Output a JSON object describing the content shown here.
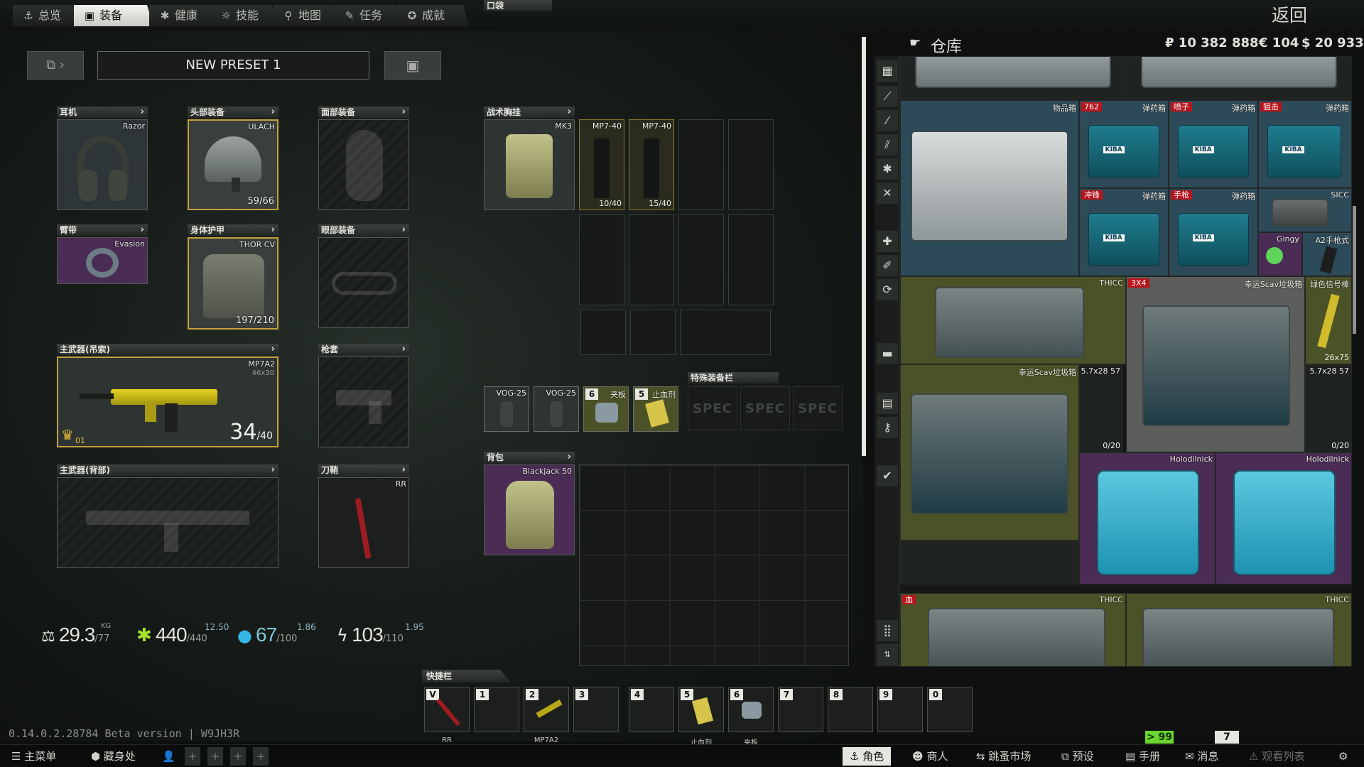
{
  "nav": {
    "tabs": [
      {
        "label": "总览",
        "icon": "anchor-icon"
      },
      {
        "label": "装备",
        "icon": "vest-icon"
      },
      {
        "label": "健康",
        "icon": "health-icon"
      },
      {
        "label": "技能",
        "icon": "skills-icon"
      },
      {
        "label": "地图",
        "icon": "map-pin-icon"
      },
      {
        "label": "任务",
        "icon": "tasks-icon"
      },
      {
        "label": "成就",
        "icon": "achievement-icon"
      }
    ],
    "back_label": "返回"
  },
  "preset": {
    "name": "NEW PRESET 1"
  },
  "slots": {
    "earpiece": {
      "label": "耳机",
      "item": "Razor"
    },
    "headwear": {
      "label": "头部装备",
      "item": "ULACH",
      "durability": "59/66"
    },
    "face_cover": {
      "label": "面部装备"
    },
    "armband": {
      "label": "臂带",
      "item": "Evasion"
    },
    "body_armor": {
      "label": "身体护甲",
      "item": "THOR CV",
      "durability": "197/210"
    },
    "eyewear": {
      "label": "眼部装备"
    },
    "primary_sling": {
      "label": "主武器(吊索)",
      "item": "MP7A2",
      "caliber": "46x30",
      "ammo": "34",
      "ammo_max": "/40",
      "level": "01"
    },
    "holster": {
      "label": "枪套"
    },
    "primary_back": {
      "label": "主武器(背部)"
    },
    "scabbard": {
      "label": "刀鞘",
      "item": "RR"
    },
    "rig": {
      "label": "战术胸挂",
      "item": "MK3",
      "mags": [
        {
          "name": "MP7-40",
          "count": "10/40"
        },
        {
          "name": "MP7-40",
          "count": "15/40"
        }
      ]
    },
    "pockets": {
      "label": "口袋",
      "items": [
        {
          "name": "VOG-25"
        },
        {
          "name": "VOG-25"
        },
        {
          "name": "夹板",
          "count": "6"
        },
        {
          "name": "止血剂",
          "count": "5"
        }
      ]
    },
    "special": {
      "label": "特殊装备栏",
      "spec_labels": [
        "SPEC",
        "SPEC",
        "SPEC"
      ]
    },
    "backpack": {
      "label": "背包",
      "item": "Blackjack 50"
    }
  },
  "stats": {
    "weight": {
      "value": "29.3",
      "unit": "KG",
      "max": "/77"
    },
    "health": {
      "value": "440",
      "max": "/440",
      "gain": "12.50"
    },
    "hydration": {
      "value": "67",
      "max": "/100",
      "gain": "1.86"
    },
    "energy": {
      "value": "103",
      "max": "/110",
      "gain": "1.95"
    }
  },
  "hotbar": {
    "label": "快捷栏",
    "slots": [
      {
        "key": "V",
        "label": "RR"
      },
      {
        "key": "1",
        "label": ""
      },
      {
        "key": "2",
        "label": "MP7A2"
      },
      {
        "key": "3",
        "label": ""
      },
      {
        "key": "4",
        "label": ""
      },
      {
        "key": "5",
        "label": "止血剂"
      },
      {
        "key": "6",
        "label": "夹板"
      },
      {
        "key": "7",
        "label": ""
      },
      {
        "key": "8",
        "label": ""
      },
      {
        "key": "9",
        "label": ""
      },
      {
        "key": "0",
        "label": ""
      }
    ]
  },
  "stash": {
    "title": "仓库",
    "currency": {
      "rub": "₽ 10 382 888",
      "eur": "€ 104",
      "usd": "$ 20 933"
    },
    "items": {
      "item_case": {
        "name": "物品箱"
      },
      "ammo1": {
        "name": "弹药箱",
        "tag": "762"
      },
      "ammo2": {
        "name": "弹药箱",
        "tag": "喷子"
      },
      "ammo3": {
        "name": "弹药箱",
        "tag": "狙击"
      },
      "ammo4": {
        "name": "弹药箱",
        "tag": "冲锋"
      },
      "ammo5": {
        "name": "弹药箱",
        "tag": "手枪"
      },
      "sicc": {
        "name": "SICC"
      },
      "gingy": {
        "name": "Gingy"
      },
      "a2": {
        "name": "A2手枪式"
      },
      "thicc1": {
        "name": "THICC",
        "tag": "3X4"
      },
      "lucky1": {
        "name": "幸运Scav垃圾箱"
      },
      "flare": {
        "name": "绿色信号棒",
        "count": "26x75"
      },
      "lucky2": {
        "name": "幸运Scav垃圾箱"
      },
      "mag57a": {
        "name": "5.7x28 57",
        "count": "0/20"
      },
      "mag57b": {
        "name": "5.7x28 57",
        "count": "0/20"
      },
      "holo1": {
        "name": "Holodilnick"
      },
      "holo2": {
        "name": "Holodilnick"
      },
      "thicc2": {
        "name": "THICC",
        "tag": "血"
      },
      "thicc3": {
        "name": "THICC"
      }
    }
  },
  "version": "0.14.0.2.28784 Beta version | W9JH3R",
  "status": {
    "fps": "> 99",
    "ping": "7"
  },
  "bottom_bar": {
    "left": [
      "主菜单",
      "藏身处"
    ],
    "right": [
      "角色",
      "商人",
      "跳蚤市场",
      "预设",
      "手册",
      "消息",
      "观看列表"
    ]
  },
  "colors": {
    "accent_yellow": "#c6a03c",
    "tag_red": "#b8141c",
    "fps_green": "#6bd62c"
  }
}
